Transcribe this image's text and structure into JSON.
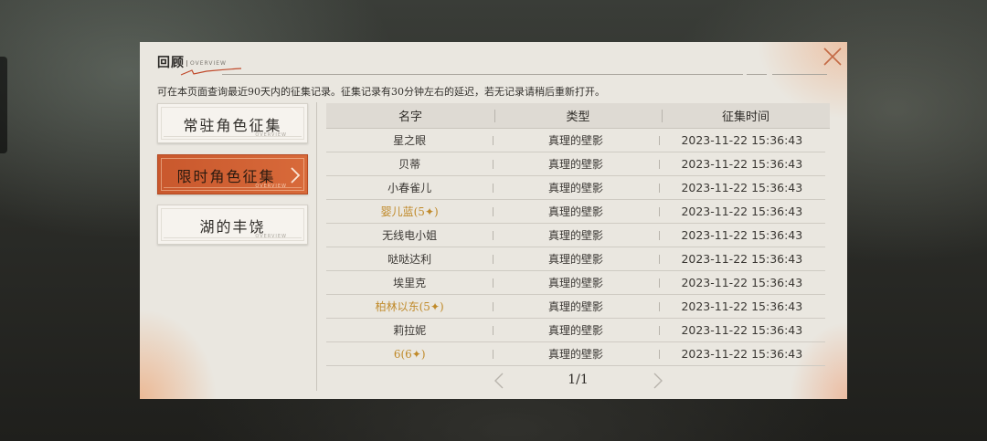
{
  "panel": {
    "title": "回顾",
    "subtitle": "OVERVIEW",
    "notice": "可在本页面查询最近90天内的征集记录。征集记录有30分钟左右的延迟，若无记录请稍后重新打开。"
  },
  "categories": [
    {
      "label": "常驻角色征集",
      "deco": "OVERVIEW",
      "active": false
    },
    {
      "label": "限时角色征集",
      "deco": "OVERVIEW",
      "active": true
    },
    {
      "label": "湖的丰饶",
      "deco": "OVERVIEW",
      "active": false
    }
  ],
  "table": {
    "headers": [
      "名字",
      "类型",
      "征集时间"
    ],
    "rows": [
      {
        "name": "星之眼",
        "type": "真理的壁影",
        "time": "2023-11-22 15:36:43",
        "rare": false
      },
      {
        "name": "贝蒂",
        "type": "真理的壁影",
        "time": "2023-11-22 15:36:43",
        "rare": false
      },
      {
        "name": "小春雀儿",
        "type": "真理的壁影",
        "time": "2023-11-22 15:36:43",
        "rare": false
      },
      {
        "name": "婴儿蓝(5✦)",
        "type": "真理的壁影",
        "time": "2023-11-22 15:36:43",
        "rare": true
      },
      {
        "name": "无线电小姐",
        "type": "真理的壁影",
        "time": "2023-11-22 15:36:43",
        "rare": false
      },
      {
        "name": "哒哒达利",
        "type": "真理的壁影",
        "time": "2023-11-22 15:36:43",
        "rare": false
      },
      {
        "name": "埃里克",
        "type": "真理的壁影",
        "time": "2023-11-22 15:36:43",
        "rare": false
      },
      {
        "name": "柏林以东(5✦)",
        "type": "真理的壁影",
        "time": "2023-11-22 15:36:43",
        "rare": true
      },
      {
        "name": "莉拉妮",
        "type": "真理的壁影",
        "time": "2023-11-22 15:36:43",
        "rare": false
      },
      {
        "name": "6(6✦)",
        "type": "真理的壁影",
        "time": "2023-11-22 15:36:43",
        "rare": true
      }
    ]
  },
  "pager": {
    "page": "1/1"
  },
  "colors": {
    "accent": "#d0602f",
    "rare": "#c08a2a",
    "panel": "#eae7e0"
  },
  "icons": {
    "close": "close-icon",
    "prev": "chevron-left-icon",
    "next": "chevron-right-icon",
    "active_arrow": "chevron-right-icon"
  }
}
